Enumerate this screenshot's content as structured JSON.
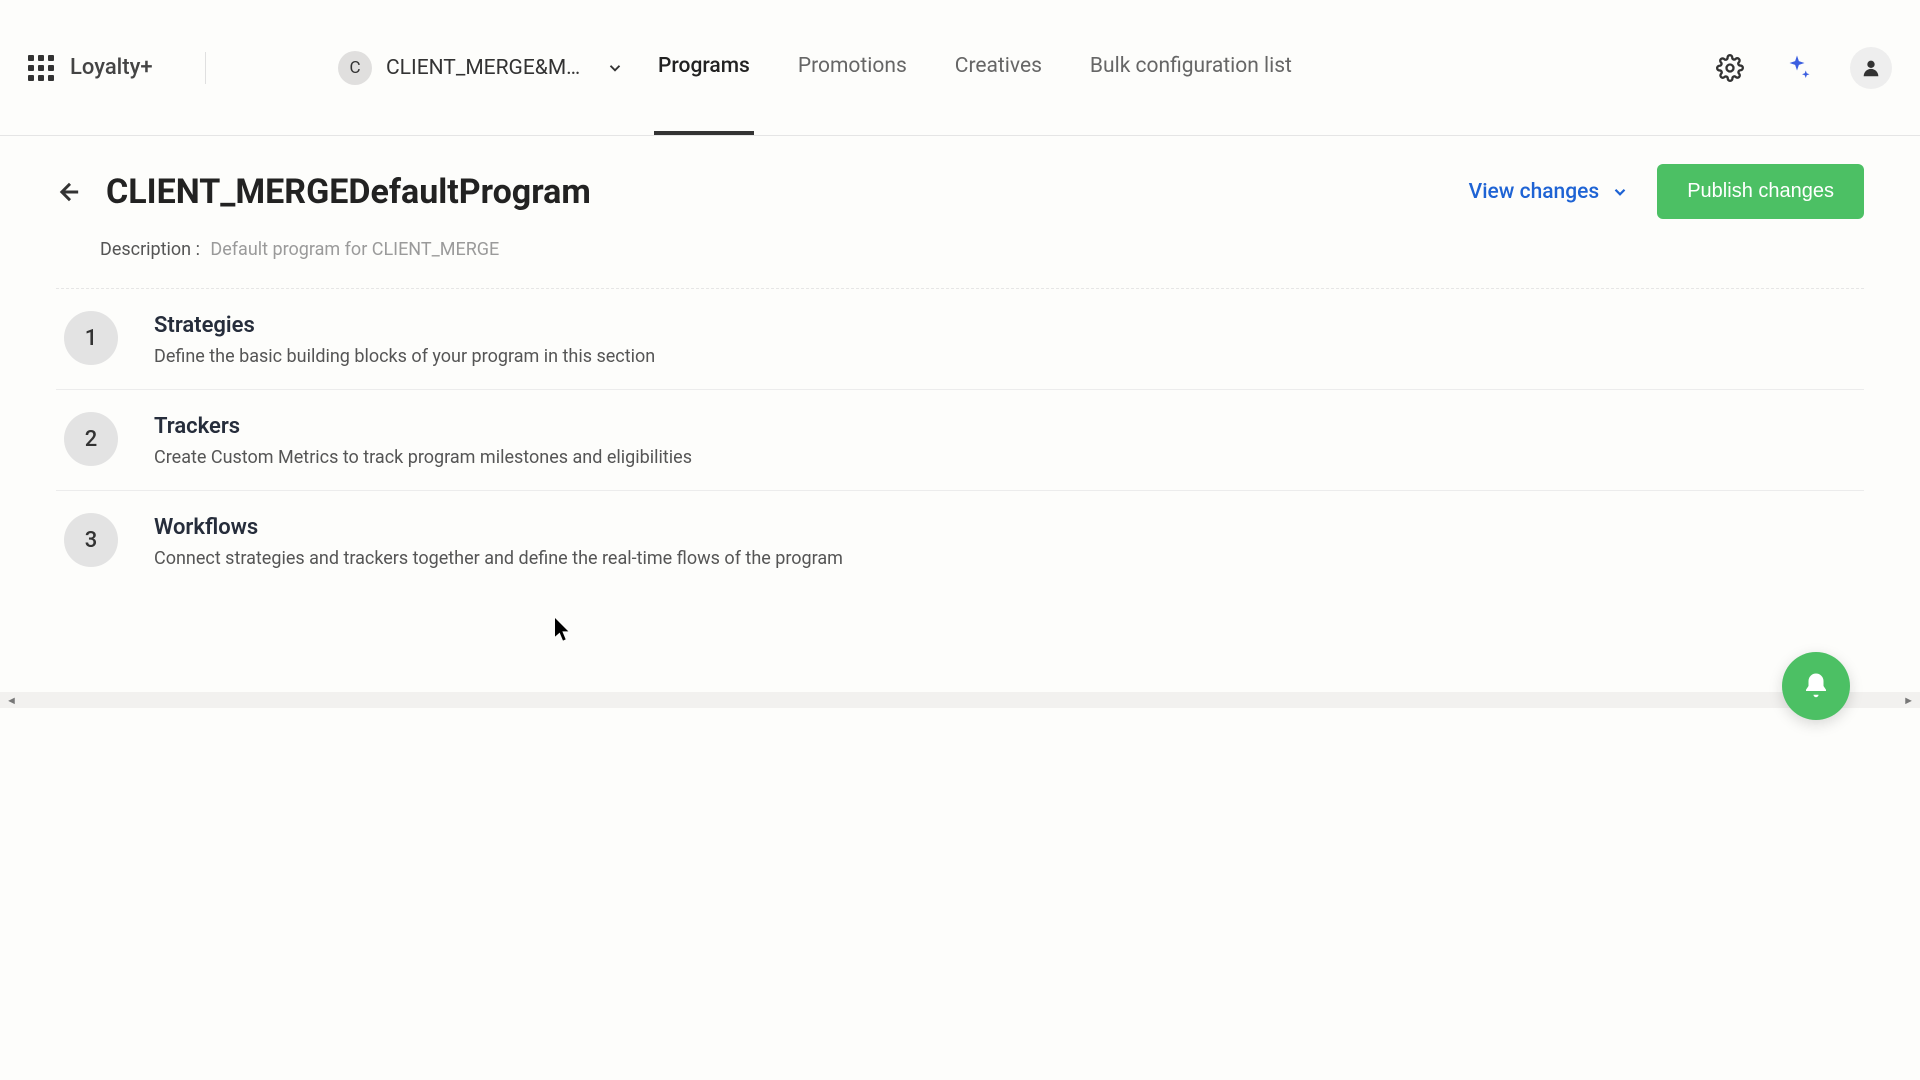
{
  "header": {
    "logo": "Loyalty+",
    "client": {
      "badge": "C",
      "name": "CLIENT_MERGE&MER…"
    },
    "tabs": [
      {
        "label": "Programs",
        "active": true
      },
      {
        "label": "Promotions",
        "active": false
      },
      {
        "label": "Creatives",
        "active": false
      },
      {
        "label": "Bulk configuration list",
        "active": false
      }
    ]
  },
  "page": {
    "title": "CLIENT_MERGEDefaultProgram",
    "description_label": "Description :",
    "description_text": "Default program for CLIENT_MERGE",
    "view_changes_label": "View changes",
    "publish_label": "Publish changes"
  },
  "steps": [
    {
      "num": "1",
      "title": "Strategies",
      "desc": "Define the basic building blocks of your program in this section"
    },
    {
      "num": "2",
      "title": "Trackers",
      "desc": "Create Custom Metrics to track program milestones and eligibilities"
    },
    {
      "num": "3",
      "title": "Workflows",
      "desc": "Connect strategies and trackers together and define the real-time flows of the program"
    }
  ],
  "colors": {
    "accent_green": "#4cc064",
    "link_blue": "#1e63d4"
  }
}
